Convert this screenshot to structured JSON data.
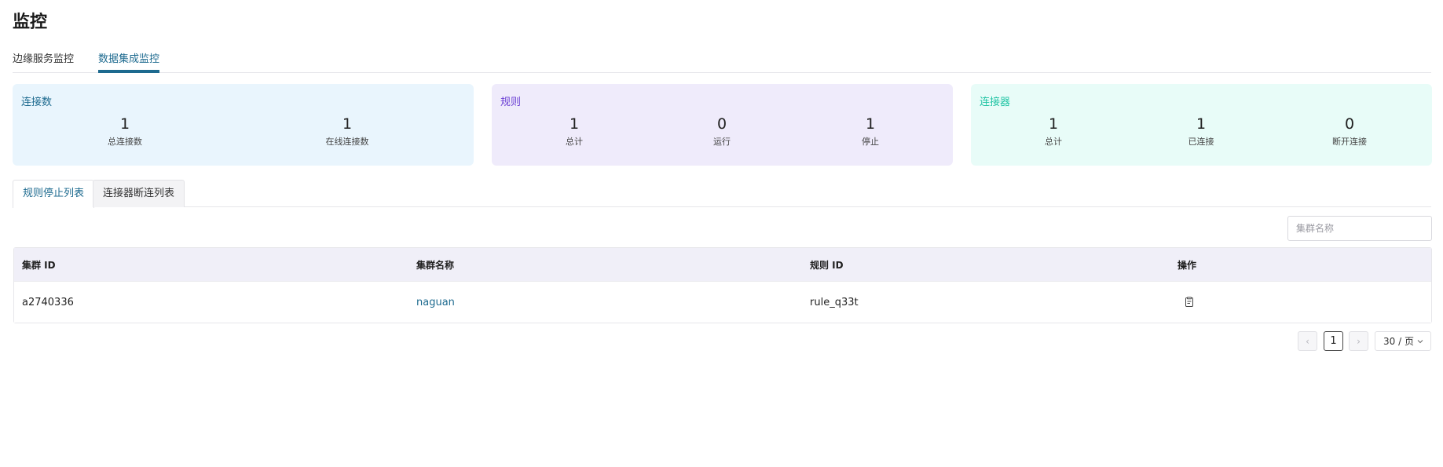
{
  "page": {
    "title": "监控"
  },
  "top_tabs": [
    {
      "label": "边缘服务监控",
      "active": false
    },
    {
      "label": "数据集成监控",
      "active": true
    }
  ],
  "cards": {
    "connections": {
      "title": "连接数",
      "stats": [
        {
          "value": "1",
          "label": "总连接数"
        },
        {
          "value": "1",
          "label": "在线连接数"
        }
      ],
      "accent": "#1d6a8f"
    },
    "rules": {
      "title": "规则",
      "stats": [
        {
          "value": "1",
          "label": "总计"
        },
        {
          "value": "0",
          "label": "运行"
        },
        {
          "value": "1",
          "label": "停止"
        }
      ],
      "accent": "#6a3fd4"
    },
    "connectors": {
      "title": "连接器",
      "stats": [
        {
          "value": "1",
          "label": "总计"
        },
        {
          "value": "1",
          "label": "已连接"
        },
        {
          "value": "0",
          "label": "断开连接"
        }
      ],
      "accent": "#20c4a4"
    }
  },
  "sub_tabs": [
    {
      "label": "规则停止列表",
      "active": true
    },
    {
      "label": "连接器断连列表",
      "active": false
    }
  ],
  "search": {
    "placeholder": "集群名称",
    "value": ""
  },
  "table": {
    "columns": [
      "集群 ID",
      "集群名称",
      "规则 ID",
      "操作"
    ],
    "rows": [
      {
        "cluster_id": "a2740336",
        "cluster_name": "naguan",
        "rule_id": "rule_q33t",
        "action_icon": "clipboard-icon"
      }
    ]
  },
  "pagination": {
    "prev_icon": "chevron-left-icon",
    "next_icon": "chevron-right-icon",
    "current_page": "1",
    "page_size": "30 / 页"
  },
  "colors": {
    "link": "#1d6a8f",
    "header_bg": "#f0eff8"
  }
}
